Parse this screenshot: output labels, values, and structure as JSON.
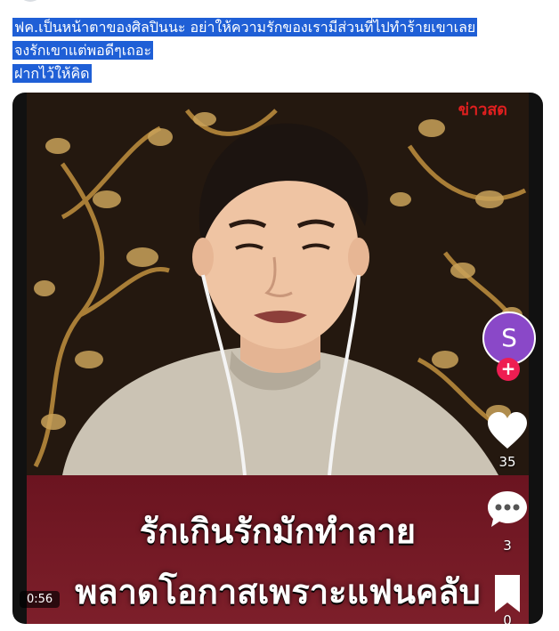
{
  "post": {
    "caption_lines": [
      "ฟค.เป็นหน้าตาของศิลปินนะ อย่าให้ความรักของเรามีส่วนที่ไปทำร้ายเขาเลย",
      "จงรักเขาแต่พอดีๆเถอะ",
      "ฝากไว้ให้คิด"
    ]
  },
  "video": {
    "watermark": "ข่าวสด",
    "banner_line_1": "รักเกินรักมักทำลาย",
    "banner_line_2": "พลาดโอกาสเพราะแฟนคลับ",
    "creator_initial": "S",
    "follow_symbol": "+",
    "likes": "35",
    "comments": "3",
    "saves": "0",
    "duration": "0:56"
  },
  "icons": {
    "like": "heart-icon",
    "comment": "comment-bubble-icon",
    "save": "bookmark-icon"
  },
  "colors": {
    "selection": "#1f5fd6",
    "creator_avatar": "#8a48c8",
    "follow_button": "#ee1d52",
    "banner": "#7d1f2a",
    "watermark": "#e01f1f"
  }
}
